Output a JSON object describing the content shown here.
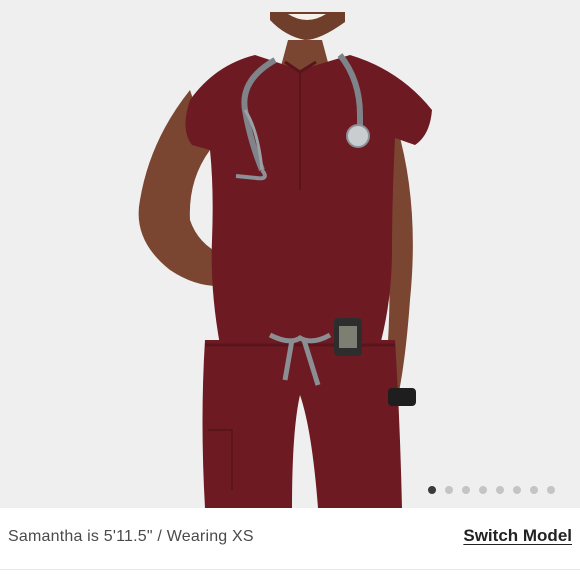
{
  "gallery": {
    "image_alt": "Model wearing burgundy scrub top and jogger pants with stethoscope",
    "slide_count": 8,
    "active_slide": 1,
    "colors": {
      "background": "#efefef",
      "scrub": "#6e1a22",
      "skin": "#7a4632"
    }
  },
  "caption": {
    "model_info": "Samantha is 5'11.5\" / Wearing XS",
    "switch_model_label": "Switch Model"
  },
  "icons": [
    "stethoscope-icon",
    "pager-icon",
    "watch-icon"
  ]
}
